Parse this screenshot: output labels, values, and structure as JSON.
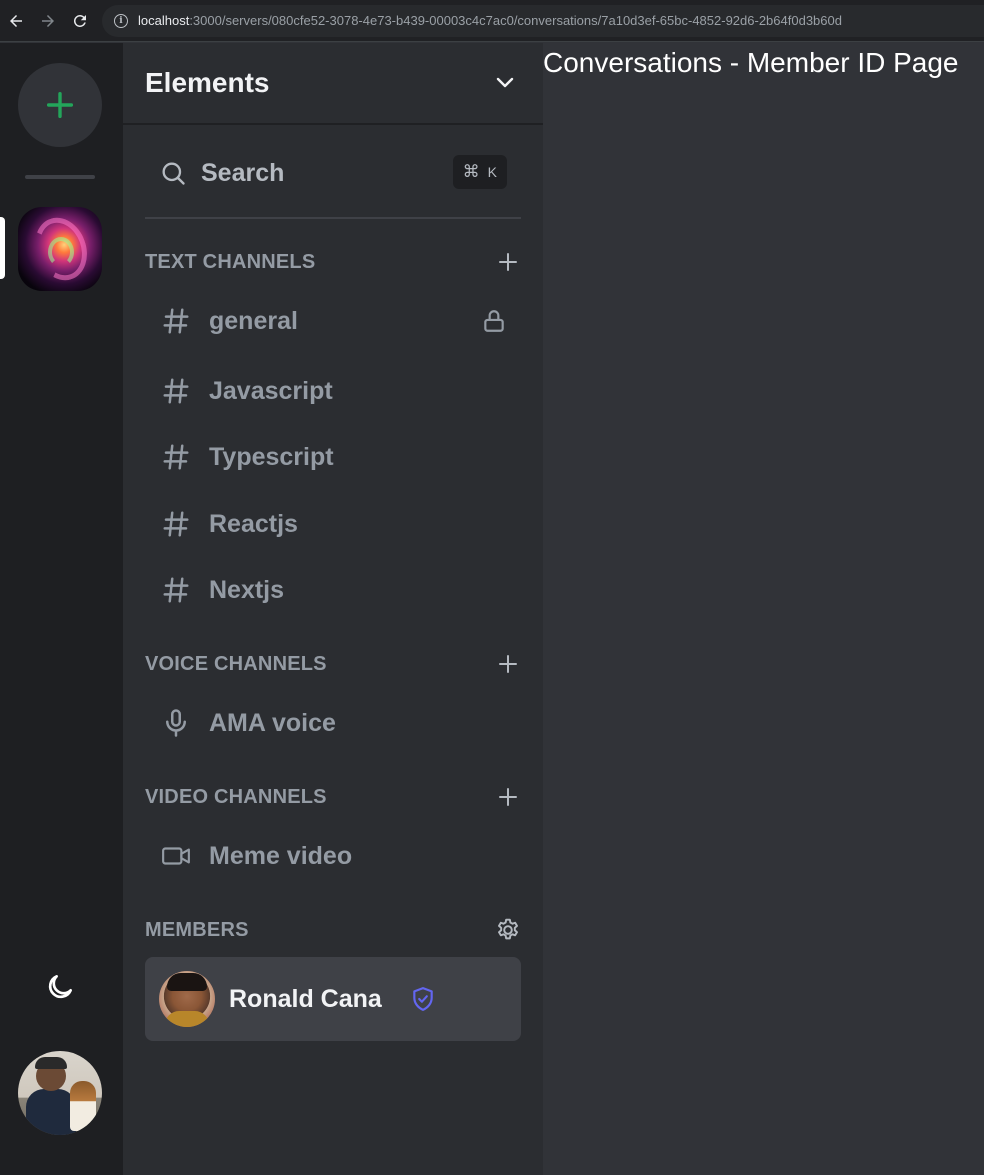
{
  "browser": {
    "url_host": "localhost",
    "url_rest": ":3000/servers/080cfe52-3078-4e73-b439-00003c4c7ac0/conversations/7a10d3ef-65bc-4852-92d6-2b64f0d3b60d"
  },
  "rail": {
    "icons": [
      "plus-icon",
      "moon-icon"
    ],
    "accent": "#23a55a"
  },
  "server": {
    "name": "Elements"
  },
  "search": {
    "label": "Search",
    "shortcut_symbol": "⌘",
    "shortcut_key": "K"
  },
  "sections": {
    "text": "TEXT CHANNELS",
    "voice": "VOICE CHANNELS",
    "video": "VIDEO CHANNELS",
    "members": "MEMBERS"
  },
  "text_channels": [
    "general",
    "Javascript",
    "Typescript",
    "Reactjs",
    "Nextjs"
  ],
  "voice_channels": [
    "AMA voice"
  ],
  "video_channels": [
    "Meme video"
  ],
  "members": [
    {
      "name": "Ronald Cana",
      "badge": "shield-check-icon",
      "badge_color": "#6366f1"
    }
  ],
  "main": {
    "title": "Conversations - Member ID Page"
  }
}
